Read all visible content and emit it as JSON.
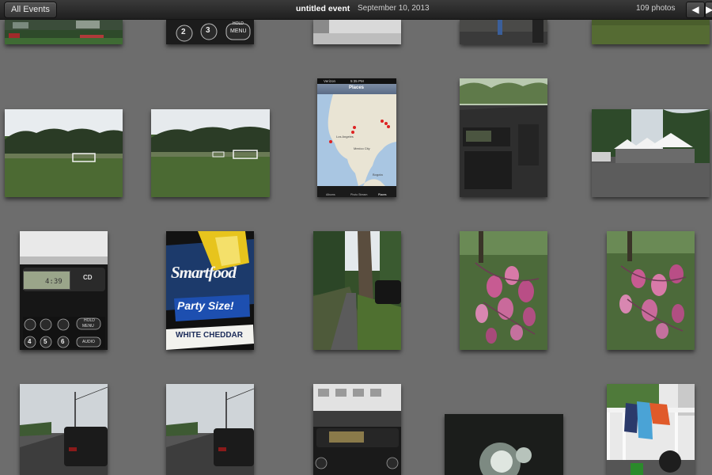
{
  "topbar": {
    "back_label": "All Events",
    "event_title": "untitled event",
    "event_date": "September 10, 2013",
    "photo_count": "109 photos",
    "prev_icon": "arrow-left-icon",
    "next_icon": "arrow-right-icon"
  },
  "photos": [
    {
      "subject": "soccer field top partial"
    },
    {
      "subject": "car radio buttons top partial"
    },
    {
      "subject": "street top partial"
    },
    {
      "subject": "kid outdoors top partial"
    },
    {
      "subject": "grass top partial"
    },
    {
      "subject": "soccer field"
    },
    {
      "subject": "soccer field"
    },
    {
      "subject": "places map screenshot"
    },
    {
      "subject": "car dashboard"
    },
    {
      "subject": "party tents"
    },
    {
      "subject": "car radio"
    },
    {
      "subject": "popcorn bag"
    },
    {
      "subject": "sidewalk with tree"
    },
    {
      "subject": "pink leaves"
    },
    {
      "subject": "pink leaves"
    },
    {
      "subject": "street with car"
    },
    {
      "subject": "street with car"
    },
    {
      "subject": "car radio"
    },
    {
      "subject": "blurry light"
    },
    {
      "subject": "laundry on porch"
    }
  ],
  "map_screen": {
    "carrier": "Verizon",
    "time": "5:35 PM",
    "title": "Places",
    "places": [
      "Los Angeles",
      "Mexico City",
      "Bogota"
    ],
    "tabs": [
      "Albums",
      "Photo Stream",
      "Places"
    ]
  },
  "popcorn_bag": {
    "brand": "Smartfood",
    "size_label": "Party Size!",
    "flavor": "WHITE CHEDDAR"
  },
  "radio": {
    "display": "4:39",
    "cd_label": "CD",
    "hold_label": "HOLD",
    "menu_label": "MENU",
    "audio_label": "AUDIO",
    "numbers": [
      "2",
      "3",
      "4",
      "5",
      "6"
    ]
  }
}
